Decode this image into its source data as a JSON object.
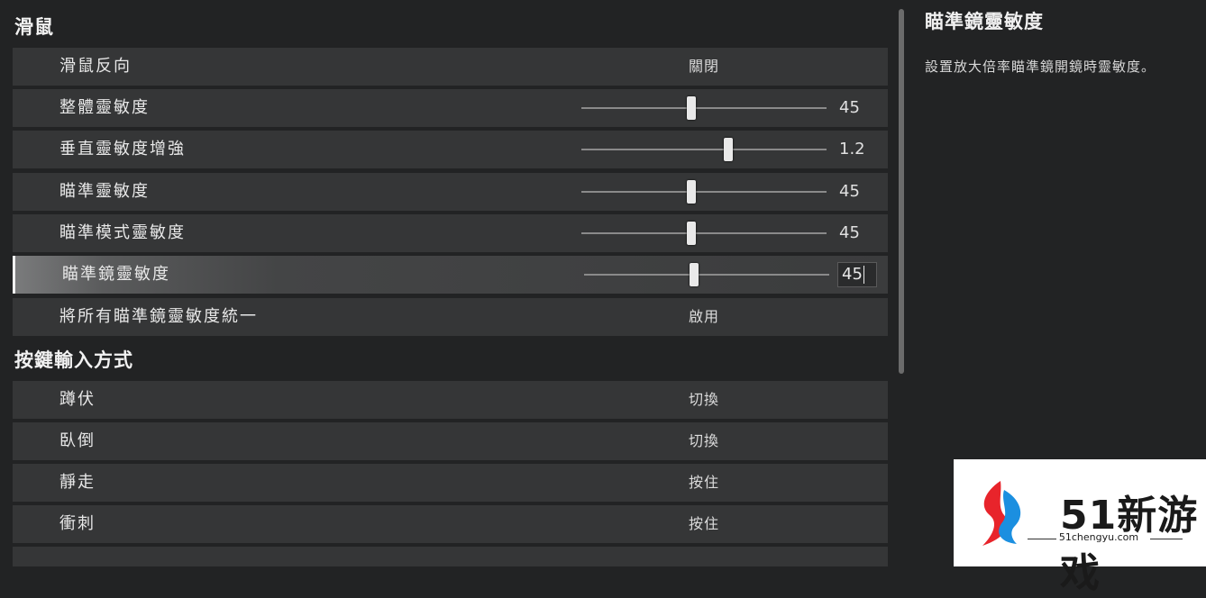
{
  "sections": {
    "mouse": {
      "title": "滑鼠"
    },
    "input": {
      "title": "按鍵輸入方式"
    }
  },
  "rows": {
    "invert": {
      "label": "滑鼠反向",
      "value": "關閉"
    },
    "overall": {
      "label": "整體靈敏度",
      "value": "45",
      "level": 0.45
    },
    "vertical": {
      "label": "垂直靈敏度增強",
      "value": "1.2",
      "level": 0.6
    },
    "aim": {
      "label": "瞄準靈敏度",
      "value": "45",
      "level": 0.45
    },
    "aimmode": {
      "label": "瞄準模式靈敏度",
      "value": "45",
      "level": 0.45
    },
    "scope": {
      "label": "瞄準鏡靈敏度",
      "value": "45",
      "level": 0.45
    },
    "unify": {
      "label": "將所有瞄準鏡靈敏度統一",
      "value": "啟用"
    },
    "crouch": {
      "label": "蹲伏",
      "value": "切換"
    },
    "prone": {
      "label": "臥倒",
      "value": "切換"
    },
    "walk": {
      "label": "靜走",
      "value": "按住"
    },
    "sprint": {
      "label": "衝刺",
      "value": "按住"
    }
  },
  "detail": {
    "title": "瞄準鏡靈敏度",
    "description": "設置放大倍率瞄準鏡開鏡時靈敏度。"
  },
  "watermark": {
    "text": "51新游戏",
    "url": "51chengyu.com"
  }
}
